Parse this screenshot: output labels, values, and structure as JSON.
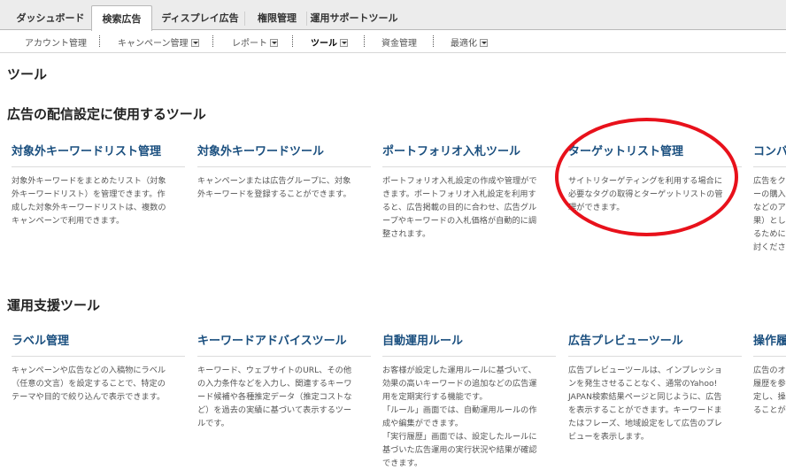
{
  "tabs": [
    {
      "label": "ダッシュボード"
    },
    {
      "label": "検索広告"
    },
    {
      "label": "ディスプレイ広告"
    },
    {
      "label": "権限管理"
    },
    {
      "label": "運用サポートツール"
    }
  ],
  "subnav": [
    {
      "label": "アカウント管理"
    },
    {
      "label": "キャンペーン管理"
    },
    {
      "label": "レポート"
    },
    {
      "label": "ツール"
    },
    {
      "label": "資金管理"
    },
    {
      "label": "最適化"
    }
  ],
  "page_title": "ツール",
  "sections": [
    {
      "title": "広告の配信設定に使用するツール",
      "cards": [
        {
          "title": "対象外キーワードリスト管理",
          "desc": [
            "対象外キーワードをまとめたリスト（対象",
            "外キーワードリスト）を管理できます。作",
            "成した対象外キーワードリストは、複数の",
            "キャンペーンで利用できます。"
          ]
        },
        {
          "title": "対象外キーワードツール",
          "desc": [
            "キャンペーンまたは広告グループに、対象",
            "外キーワードを登録することができます。"
          ]
        },
        {
          "title": "ポートフォリオ入札ツール",
          "desc": [
            "ポートフォリオ入札設定の作成や管理がで",
            "きます。ポートフォリオ入札設定を利用す",
            "ると、広告掲載の目的に合わせ、広告グル",
            "ープやキーワードの入札価格が自動的に調",
            "整されます。"
          ]
        },
        {
          "title": "ターゲットリスト管理",
          "desc": [
            "サイトリターゲティングを利用する場合に",
            "必要なタグの取得とターゲットリストの管",
            "理ができます。"
          ]
        },
        {
          "title": "コンバ",
          "desc": [
            "広告をク",
            "ーの購入",
            "などのア",
            "果）とし",
            "るために",
            "討くださ"
          ]
        }
      ]
    },
    {
      "title": "運用支援ツール",
      "cards": [
        {
          "title": "ラベル管理",
          "desc": [
            "キャンペーンや広告などの入稿物にラベル",
            "（任意の文言）を設定することで、特定の",
            "テーマや目的で絞り込んで表示できます。"
          ]
        },
        {
          "title": "キーワードアドバイスツール",
          "desc": [
            "キーワード、ウェブサイトのURL、その他",
            "の入力条件などを入力し、関連するキーワ",
            "ード候補や各種推定データ（推定コストな",
            "ど）を過去の実績に基づいて表示するツー",
            "ルです。"
          ]
        },
        {
          "title": "自動運用ルール",
          "desc": [
            "お客様が設定した運用ルールに基づいて、",
            "効果の高いキーワードの追加などの広告運",
            "用を定期実行する機能です。",
            "「ルール」画面では、自動運用ルールの作",
            "成や編集ができます。",
            "「実行履歴」画面では、設定したルールに",
            "基づいた広告運用の実行状況や結果が確認",
            "できます。"
          ]
        },
        {
          "title": "広告プレビューツール",
          "desc": [
            "広告プレビューツールは、インプレッショ",
            "ンを発生させることなく、通常のYahoo!",
            "JAPAN検索結果ページと同じように、広告",
            "を表示することができます。キーワードま",
            "たはフレーズ、地域設定をして広告のプレ",
            "ビューを表示します。"
          ]
        },
        {
          "title": "操作履",
          "desc": [
            "広告のオ",
            "履歴を参",
            "定し、操",
            "ることが"
          ]
        }
      ]
    }
  ],
  "colors": {
    "accent_link": "#1a4f7f",
    "highlight_ring": "#e8111b"
  }
}
